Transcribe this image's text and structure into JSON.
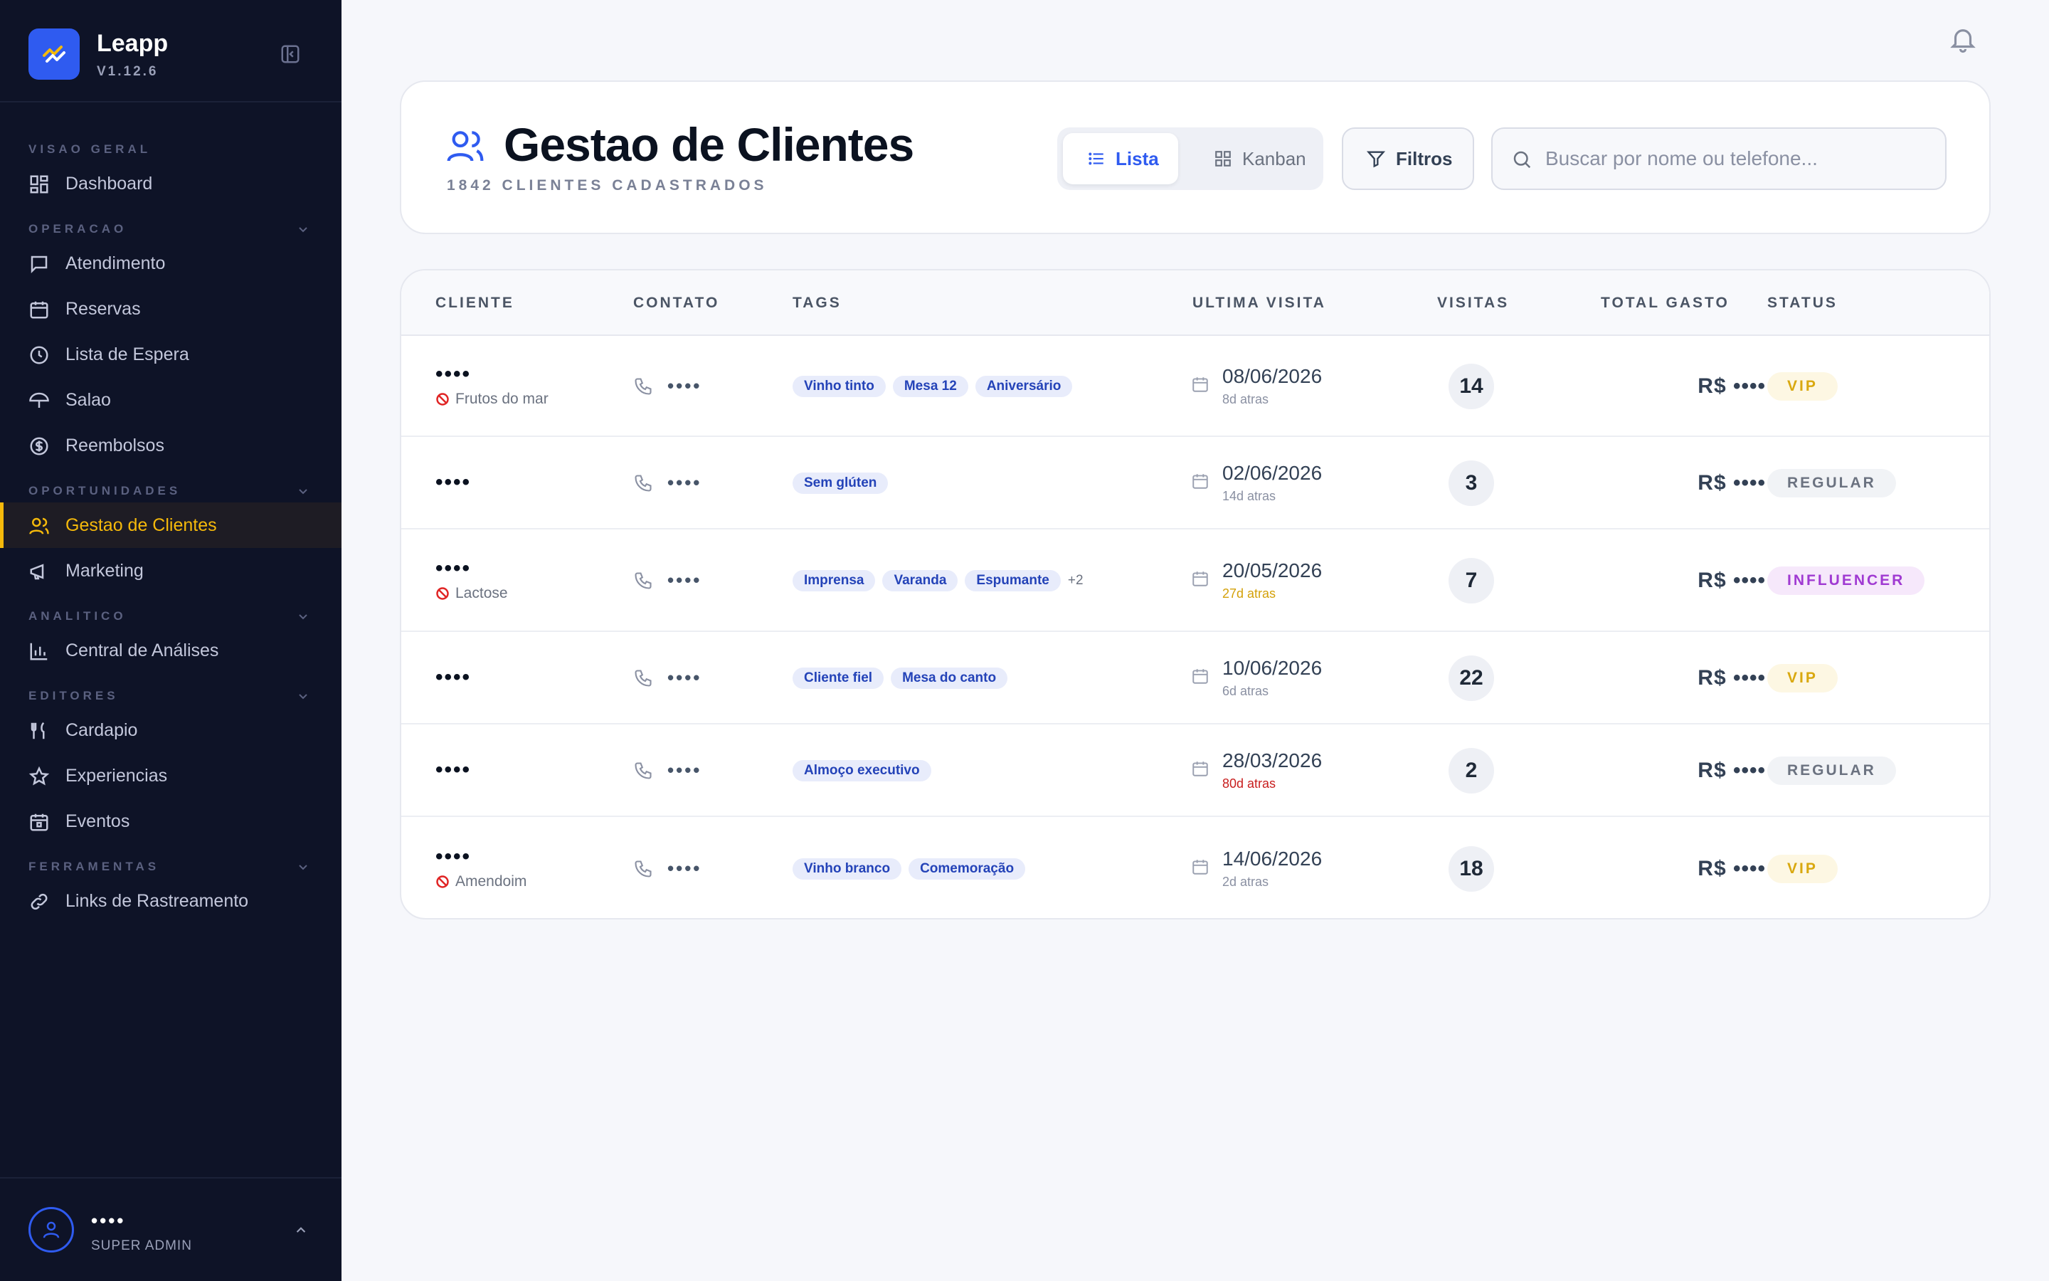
{
  "app": {
    "name": "Leapp",
    "version": "V1.12.6"
  },
  "sidebar": {
    "sections": [
      {
        "label": "VISAO GERAL",
        "items": [
          {
            "label": "Dashboard",
            "icon": "dashboard-icon"
          }
        ]
      },
      {
        "label": "OPERACAO",
        "items": [
          {
            "label": "Atendimento",
            "icon": "message-icon"
          },
          {
            "label": "Reservas",
            "icon": "calendar-icon"
          },
          {
            "label": "Lista de Espera",
            "icon": "clock-icon"
          },
          {
            "label": "Salao",
            "icon": "umbrella-icon"
          },
          {
            "label": "Reembolsos",
            "icon": "dollar-icon"
          }
        ]
      },
      {
        "label": "OPORTUNIDADES",
        "items": [
          {
            "label": "Gestao de Clientes",
            "icon": "users-icon",
            "active": true
          },
          {
            "label": "Marketing",
            "icon": "megaphone-icon"
          }
        ]
      },
      {
        "label": "ANALITICO",
        "items": [
          {
            "label": "Central de Análises",
            "icon": "bar-chart-icon"
          }
        ]
      },
      {
        "label": "EDITORES",
        "items": [
          {
            "label": "Cardapio",
            "icon": "utensils-icon"
          },
          {
            "label": "Experiencias",
            "icon": "star-icon"
          },
          {
            "label": "Eventos",
            "icon": "calendar-event-icon"
          }
        ]
      },
      {
        "label": "FERRAMENTAS",
        "items": [
          {
            "label": "Links de Rastreamento",
            "icon": "link-icon"
          }
        ]
      }
    ],
    "user": {
      "name": "••••",
      "role": "SUPER ADMIN"
    }
  },
  "header": {
    "title": "Gestao de Clientes",
    "subtitle": "1842 CLIENTES CADASTRADOS",
    "view_list": "Lista",
    "view_kanban": "Kanban",
    "filters": "Filtros",
    "search_placeholder": "Buscar por nome ou telefone..."
  },
  "table": {
    "columns": {
      "cliente": "CLIENTE",
      "contato": "CONTATO",
      "tags": "TAGS",
      "ultima": "ULTIMA VISITA",
      "visitas": "VISITAS",
      "gasto": "TOTAL GASTO",
      "status": "STATUS"
    },
    "rows": [
      {
        "name": "••••",
        "allergy": "Frutos do mar",
        "contact": "••••",
        "tags": [
          "Vinho tinto",
          "Mesa 12",
          "Aniversário"
        ],
        "more": "",
        "date": "08/06/2026",
        "ago": "8d atras",
        "ago_level": "normal",
        "visits": "14",
        "spent": "R$ ••••",
        "status": "VIP",
        "status_type": "vip"
      },
      {
        "name": "••••",
        "allergy": "",
        "contact": "••••",
        "tags": [
          "Sem glúten"
        ],
        "more": "",
        "date": "02/06/2026",
        "ago": "14d atras",
        "ago_level": "normal",
        "visits": "3",
        "spent": "R$ ••••",
        "status": "REGULAR",
        "status_type": "regular"
      },
      {
        "name": "••••",
        "allergy": "Lactose",
        "contact": "••••",
        "tags": [
          "Imprensa",
          "Varanda",
          "Espumante"
        ],
        "more": "+2",
        "date": "20/05/2026",
        "ago": "27d atras",
        "ago_level": "warn",
        "visits": "7",
        "spent": "R$ ••••",
        "status": "INFLUENCER",
        "status_type": "influencer"
      },
      {
        "name": "••••",
        "allergy": "",
        "contact": "••••",
        "tags": [
          "Cliente fiel",
          "Mesa do canto"
        ],
        "more": "",
        "date": "10/06/2026",
        "ago": "6d atras",
        "ago_level": "normal",
        "visits": "22",
        "spent": "R$ ••••",
        "status": "VIP",
        "status_type": "vip"
      },
      {
        "name": "••••",
        "allergy": "",
        "contact": "••••",
        "tags": [
          "Almoço executivo"
        ],
        "more": "",
        "date": "28/03/2026",
        "ago": "80d atras",
        "ago_level": "alert",
        "visits": "2",
        "spent": "R$ ••••",
        "status": "REGULAR",
        "status_type": "regular"
      },
      {
        "name": "••••",
        "allergy": "Amendoim",
        "contact": "••••",
        "tags": [
          "Vinho branco",
          "Comemoração"
        ],
        "more": "",
        "date": "14/06/2026",
        "ago": "2d atras",
        "ago_level": "normal",
        "visits": "18",
        "spent": "R$ ••••",
        "status": "VIP",
        "status_type": "vip"
      }
    ]
  },
  "colors": {
    "sidebar_bg": "#0e1327",
    "accent": "#2f5bf0",
    "active": "#f5b90b"
  }
}
